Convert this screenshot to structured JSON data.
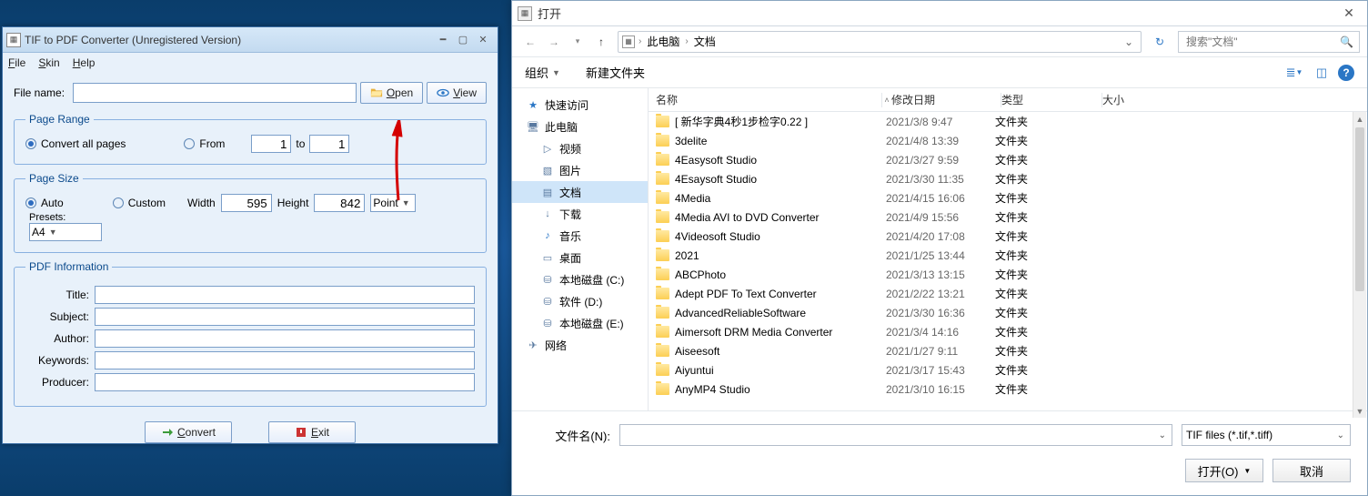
{
  "app": {
    "title": "TIF to PDF Converter (Unregistered Version)",
    "menu": {
      "file": "File",
      "skin": "Skin",
      "help": "Help"
    },
    "file_label": "File name:",
    "file_value": "",
    "open_btn": "Open",
    "view_btn": "View",
    "page_range": {
      "legend": "Page Range",
      "convert_all": "Convert all pages",
      "from": "From",
      "from_value": "1",
      "to": "to",
      "to_value": "1"
    },
    "page_size": {
      "legend": "Page Size",
      "auto": "Auto",
      "custom": "Custom",
      "width_lbl": "Width",
      "width_val": "595",
      "height_lbl": "Height",
      "height_val": "842",
      "unit": "Point",
      "presets_lbl": "Presets:",
      "preset_val": "A4"
    },
    "pdf_info": {
      "legend": "PDF Information",
      "title": "Title:",
      "subject": "Subject:",
      "author": "Author:",
      "keywords": "Keywords:",
      "producer": "Producer:"
    },
    "convert_btn": "Convert",
    "exit_btn": "Exit"
  },
  "dlg": {
    "title": "打开",
    "breadcrumbs": [
      "此电脑",
      "文档"
    ],
    "search_placeholder": "搜索\"文档\"",
    "toolbar": {
      "organize": "组织",
      "new_folder": "新建文件夹"
    },
    "columns": {
      "name": "名称",
      "date": "修改日期",
      "type": "类型",
      "size": "大小"
    },
    "sidebar": [
      {
        "label": "快速访问",
        "icon": "star",
        "level": 1
      },
      {
        "label": "此电脑",
        "icon": "pc",
        "level": 1
      },
      {
        "label": "视频",
        "icon": "video",
        "level": 2
      },
      {
        "label": "图片",
        "icon": "picture",
        "level": 2
      },
      {
        "label": "文档",
        "icon": "document",
        "level": 2,
        "selected": true
      },
      {
        "label": "下载",
        "icon": "download",
        "level": 2
      },
      {
        "label": "音乐",
        "icon": "music",
        "level": 2
      },
      {
        "label": "桌面",
        "icon": "desktop",
        "level": 2
      },
      {
        "label": "本地磁盘 (C:)",
        "icon": "disk",
        "level": 2
      },
      {
        "label": "软件 (D:)",
        "icon": "disk",
        "level": 2
      },
      {
        "label": "本地磁盘 (E:)",
        "icon": "disk",
        "level": 2
      },
      {
        "label": "网络",
        "icon": "network",
        "level": 1
      }
    ],
    "files": [
      {
        "name": "[ 新华字典4秒1步检字0.22 ]",
        "date": "2021/3/8 9:47",
        "type": "文件夹"
      },
      {
        "name": "3delite",
        "date": "2021/4/8 13:39",
        "type": "文件夹"
      },
      {
        "name": "4Easysoft Studio",
        "date": "2021/3/27 9:59",
        "type": "文件夹"
      },
      {
        "name": "4Esaysoft Studio",
        "date": "2021/3/30 11:35",
        "type": "文件夹"
      },
      {
        "name": "4Media",
        "date": "2021/4/15 16:06",
        "type": "文件夹"
      },
      {
        "name": "4Media AVI to DVD Converter",
        "date": "2021/4/9 15:56",
        "type": "文件夹"
      },
      {
        "name": "4Videosoft Studio",
        "date": "2021/4/20 17:08",
        "type": "文件夹"
      },
      {
        "name": "2021",
        "date": "2021/1/25 13:44",
        "type": "文件夹"
      },
      {
        "name": "ABCPhoto",
        "date": "2021/3/13 13:15",
        "type": "文件夹"
      },
      {
        "name": "Adept PDF To Text Converter",
        "date": "2021/2/22 13:21",
        "type": "文件夹"
      },
      {
        "name": "AdvancedReliableSoftware",
        "date": "2021/3/30 16:36",
        "type": "文件夹"
      },
      {
        "name": "Aimersoft DRM Media Converter",
        "date": "2021/3/4 14:16",
        "type": "文件夹"
      },
      {
        "name": "Aiseesoft",
        "date": "2021/1/27 9:11",
        "type": "文件夹"
      },
      {
        "name": "Aiyuntui",
        "date": "2021/3/17 15:43",
        "type": "文件夹"
      },
      {
        "name": "AnyMP4 Studio",
        "date": "2021/3/10 16:15",
        "type": "文件夹"
      }
    ],
    "file_cut": {
      "name": "",
      "date": "",
      "type": ""
    },
    "filename_lbl": "文件名(N):",
    "filename_val": "",
    "filter_val": "TIF files (*.tif,*.tiff)",
    "open_btn": "打开(O)",
    "cancel_btn": "取消"
  }
}
